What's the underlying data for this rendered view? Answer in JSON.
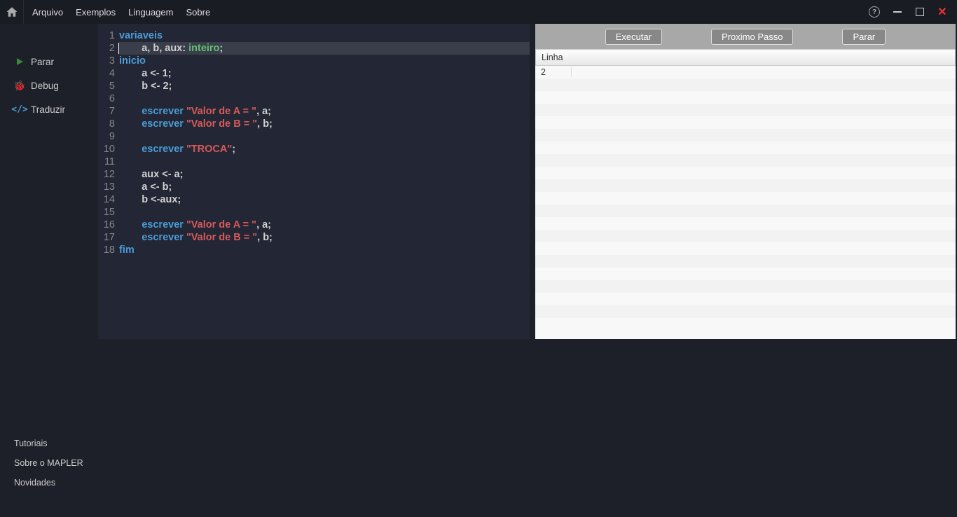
{
  "menubar": {
    "items": [
      "Arquivo",
      "Exemplos",
      "Linguagem",
      "Sobre"
    ]
  },
  "sidebar": {
    "actions": [
      {
        "label": "Parar",
        "icon": "play"
      },
      {
        "label": "Debug",
        "icon": "bug"
      },
      {
        "label": "Traduzir",
        "icon": "code"
      }
    ],
    "links": [
      "Tutoriais",
      "Sobre o MAPLER",
      "Novidades"
    ]
  },
  "editor": {
    "highlighted_line": 2,
    "lines": [
      {
        "n": 1,
        "t": [
          {
            "c": "kw",
            "v": "variaveis"
          }
        ]
      },
      {
        "n": 2,
        "t": [
          {
            "c": "pl",
            "v": "        a, b, aux"
          },
          {
            "c": "pl",
            "v": ": "
          },
          {
            "c": "ty",
            "v": "inteiro"
          },
          {
            "c": "pl",
            "v": ";"
          }
        ]
      },
      {
        "n": 3,
        "t": [
          {
            "c": "kw",
            "v": "inicio"
          }
        ]
      },
      {
        "n": 4,
        "t": [
          {
            "c": "pl",
            "v": "        a <- 1;"
          }
        ]
      },
      {
        "n": 5,
        "t": [
          {
            "c": "pl",
            "v": "        b <- 2;"
          }
        ]
      },
      {
        "n": 6,
        "t": []
      },
      {
        "n": 7,
        "t": [
          {
            "c": "pl",
            "v": "        "
          },
          {
            "c": "cmd",
            "v": "escrever"
          },
          {
            "c": "pl",
            "v": " "
          },
          {
            "c": "str",
            "v": "\"Valor de A = \""
          },
          {
            "c": "pl",
            "v": ", a;"
          }
        ]
      },
      {
        "n": 8,
        "t": [
          {
            "c": "pl",
            "v": "        "
          },
          {
            "c": "cmd",
            "v": "escrever"
          },
          {
            "c": "pl",
            "v": " "
          },
          {
            "c": "str",
            "v": "\"Valor de B = \""
          },
          {
            "c": "pl",
            "v": ", b;"
          }
        ]
      },
      {
        "n": 9,
        "t": []
      },
      {
        "n": 10,
        "t": [
          {
            "c": "pl",
            "v": "        "
          },
          {
            "c": "cmd",
            "v": "escrever"
          },
          {
            "c": "pl",
            "v": " "
          },
          {
            "c": "str",
            "v": "\"TROCA\""
          },
          {
            "c": "pl",
            "v": ";"
          }
        ]
      },
      {
        "n": 11,
        "t": []
      },
      {
        "n": 12,
        "t": [
          {
            "c": "pl",
            "v": "        aux <- a;"
          }
        ]
      },
      {
        "n": 13,
        "t": [
          {
            "c": "pl",
            "v": "        a <- b;"
          }
        ]
      },
      {
        "n": 14,
        "t": [
          {
            "c": "pl",
            "v": "        b <-aux;"
          }
        ]
      },
      {
        "n": 15,
        "t": []
      },
      {
        "n": 16,
        "t": [
          {
            "c": "pl",
            "v": "        "
          },
          {
            "c": "cmd",
            "v": "escrever"
          },
          {
            "c": "pl",
            "v": " "
          },
          {
            "c": "str",
            "v": "\"Valor de A = \""
          },
          {
            "c": "pl",
            "v": ", a;"
          }
        ]
      },
      {
        "n": 17,
        "t": [
          {
            "c": "pl",
            "v": "        "
          },
          {
            "c": "cmd",
            "v": "escrever"
          },
          {
            "c": "pl",
            "v": " "
          },
          {
            "c": "str",
            "v": "\"Valor de B = \""
          },
          {
            "c": "pl",
            "v": ", b;"
          }
        ]
      },
      {
        "n": 18,
        "t": [
          {
            "c": "kw",
            "v": "fim"
          }
        ]
      }
    ]
  },
  "debug": {
    "buttons": [
      "Executar",
      "Proximo Passo",
      "Parar"
    ],
    "header": "Linha",
    "rows": [
      "2"
    ],
    "empty_rows": 19
  }
}
